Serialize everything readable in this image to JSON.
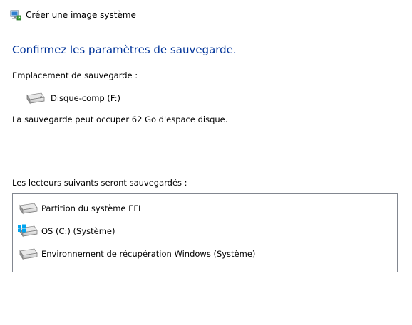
{
  "window": {
    "title": "Créer une image système",
    "icon": "backup-app-icon"
  },
  "page": {
    "heading": "Confirmez les paramètres de sauvegarde.",
    "location_label": "Emplacement de sauvegarde :",
    "location_drive": {
      "name": "Disque-comp (F:)",
      "icon": "drive-icon"
    },
    "usage_text": "La sauvegarde peut occuper 62 Go d'espace disque.",
    "drives_label": "Les lecteurs suivants seront sauvegardés :",
    "drives": [
      {
        "name": "Partition du système EFI",
        "icon": "drive-icon"
      },
      {
        "name": "OS (C:) (Système)",
        "icon": "windows-drive-icon"
      },
      {
        "name": "Environnement de récupération Windows (Système)",
        "icon": "drive-icon"
      }
    ]
  },
  "colors": {
    "heading": "#003399",
    "box_border": "#828790",
    "windows_logo": "#00a4ef"
  }
}
